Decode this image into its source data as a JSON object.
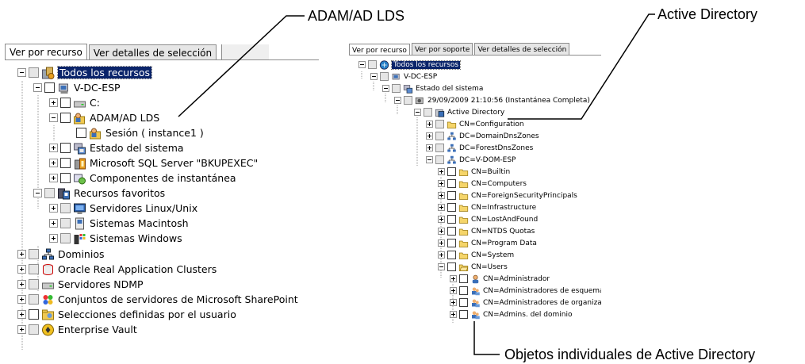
{
  "callouts": {
    "adam": "ADAM/AD LDS",
    "active_directory": "Active Directory",
    "objects": "Objetos individuales de Active Directory"
  },
  "left_panel": {
    "tabs": [
      "Ver por recurso",
      "Ver detalles de selección"
    ],
    "tree": [
      {
        "label": "Todos los recursos",
        "icon": "all-resources-icon",
        "selected": true
      },
      {
        "label": "V-DC-ESP",
        "icon": "server-icon"
      },
      {
        "label": "C:",
        "icon": "drive-icon"
      },
      {
        "label": "ADAM/AD LDS",
        "icon": "adam-icon"
      },
      {
        "label": "Sesión ( instance1 )",
        "icon": "adam-icon"
      },
      {
        "label": "Estado del sistema",
        "icon": "system-state-icon"
      },
      {
        "label": "Microsoft SQL Server \"BKUPEXEC\"",
        "icon": "sql-server-icon"
      },
      {
        "label": "Componentes de instantánea",
        "icon": "shadow-copy-icon"
      },
      {
        "label": "Recursos favoritos",
        "icon": "favorite-resources-icon"
      },
      {
        "label": "Servidores Linux/Unix",
        "icon": "linux-server-icon"
      },
      {
        "label": "Sistemas Macintosh",
        "icon": "mac-icon"
      },
      {
        "label": "Sistemas Windows",
        "icon": "windows-icon"
      },
      {
        "label": "Dominios",
        "icon": "domain-icon"
      },
      {
        "label": "Oracle Real Application Clusters",
        "icon": "oracle-icon"
      },
      {
        "label": "Servidores NDMP",
        "icon": "ndmp-icon"
      },
      {
        "label": "Conjuntos de servidores de Microsoft SharePoint",
        "icon": "sharepoint-icon"
      },
      {
        "label": "Selecciones definidas por el usuario",
        "icon": "user-selection-icon"
      },
      {
        "label": "Enterprise Vault",
        "icon": "enterprise-vault-icon"
      }
    ]
  },
  "right_panel": {
    "tabs": [
      "Ver por recurso",
      "Ver por soporte",
      "Ver detalles de selección"
    ],
    "tree": [
      {
        "label": "Todos los recursos",
        "icon": "all-resources-icon",
        "selected": true
      },
      {
        "label": "V-DC-ESP",
        "icon": "server-icon"
      },
      {
        "label": "Estado del sistema",
        "icon": "system-state-icon"
      },
      {
        "label": "29/09/2009 21:10:56 (Instantánea Completa)",
        "icon": "snapshot-icon"
      },
      {
        "label": "Active Directory",
        "icon": "active-directory-icon"
      },
      {
        "label": "CN=Configuration",
        "icon": "folder-icon"
      },
      {
        "label": "DC=DomainDnsZones",
        "icon": "domain-icon"
      },
      {
        "label": "DC=ForestDnsZones",
        "icon": "domain-icon"
      },
      {
        "label": "DC=V-DOM-ESP",
        "icon": "domain-icon"
      },
      {
        "label": "CN=Builtin",
        "icon": "folder-icon"
      },
      {
        "label": "CN=Computers",
        "icon": "folder-icon"
      },
      {
        "label": "CN=ForeignSecurityPrincipals",
        "icon": "folder-icon"
      },
      {
        "label": "CN=Infrastructure",
        "icon": "folder-icon"
      },
      {
        "label": "CN=LostAndFound",
        "icon": "folder-icon"
      },
      {
        "label": "CN=NTDS Quotas",
        "icon": "folder-icon"
      },
      {
        "label": "CN=Program Data",
        "icon": "folder-icon"
      },
      {
        "label": "CN=System",
        "icon": "folder-icon"
      },
      {
        "label": "CN=Users",
        "icon": "folder-open-icon"
      },
      {
        "label": "CN=Administrador",
        "icon": "user-icon"
      },
      {
        "label": "CN=Administradores de esquema",
        "icon": "group-icon"
      },
      {
        "label": "CN=Administradores de organizació",
        "icon": "group-icon"
      },
      {
        "label": "CN=Admins. del dominio",
        "icon": "group-icon"
      }
    ]
  }
}
